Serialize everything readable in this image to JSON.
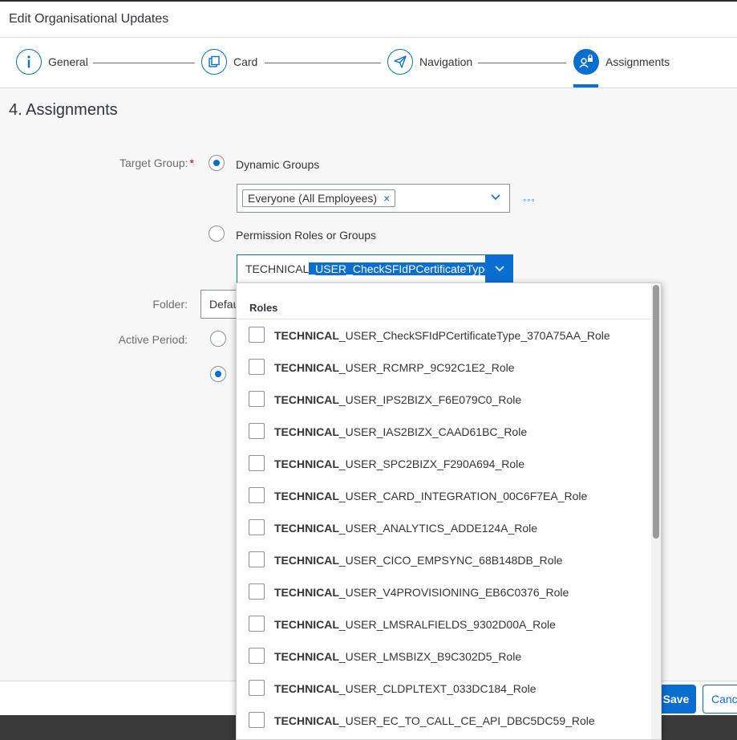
{
  "dialog": {
    "title": "Edit Organisational Updates"
  },
  "wizard": {
    "steps": [
      {
        "label": "General",
        "icon": "info-icon"
      },
      {
        "label": "Card",
        "icon": "card-copy-icon"
      },
      {
        "label": "Navigation",
        "icon": "paper-plane-icon"
      },
      {
        "label": "Assignments",
        "icon": "user-lock-icon"
      }
    ],
    "active_step": "Assignments"
  },
  "section_title": "4. Assignments",
  "form": {
    "target_group_label": "Target Group:",
    "required_mark": "*",
    "dynamic_groups_label": "Dynamic Groups",
    "dynamic_token": "Everyone (All Employees)",
    "token_remove": "×",
    "more_glyph": "◦◦◦",
    "permission_label": "Permission Roles or Groups",
    "input_prefix": "TECHNICAL",
    "input_selected": "_USER_CheckSFIdPCertificateType",
    "folder_label": "Folder:",
    "folder_value": "Defau",
    "active_period_label": "Active Period:"
  },
  "dropdown": {
    "header": "Roles",
    "items": [
      {
        "bold": "TECHNICAL",
        "rest": "_USER_CheckSFIdPCertificateType_370A75AA_Role"
      },
      {
        "bold": "TECHNICAL",
        "rest": "_USER_RCMRP_9C92C1E2_Role"
      },
      {
        "bold": "TECHNICAL",
        "rest": "_USER_IPS2BIZX_F6E079C0_Role"
      },
      {
        "bold": "TECHNICAL",
        "rest": "_USER_IAS2BIZX_CAAD61BC_Role"
      },
      {
        "bold": "TECHNICAL",
        "rest": "_USER_SPC2BIZX_F290A694_Role"
      },
      {
        "bold": "TECHNICAL",
        "rest": "_USER_CARD_INTEGRATION_00C6F7EA_Role"
      },
      {
        "bold": "TECHNICAL",
        "rest": "_USER_ANALYTICS_ADDE124A_Role"
      },
      {
        "bold": "TECHNICAL",
        "rest": "_USER_CICO_EMPSYNC_68B148DB_Role"
      },
      {
        "bold": "TECHNICAL",
        "rest": "_USER_V4PROVISIONING_EB6C0376_Role"
      },
      {
        "bold": "TECHNICAL",
        "rest": "_USER_LMSRALFIELDS_9302D00A_Role"
      },
      {
        "bold": "TECHNICAL",
        "rest": "_USER_LMSBIZX_B9C302D5_Role"
      },
      {
        "bold": "TECHNICAL",
        "rest": "_USER_CLDPLTEXT_033DC184_Role"
      },
      {
        "bold": "TECHNICAL",
        "rest": "_USER_EC_TO_CALL_CE_API_DBC5DC59_Role"
      }
    ]
  },
  "footer": {
    "save_label": "Save",
    "cancel_label": "Cancel"
  },
  "colors": {
    "accent": "#0a6ed1",
    "required": "#bb0000",
    "text": "#32363a"
  }
}
